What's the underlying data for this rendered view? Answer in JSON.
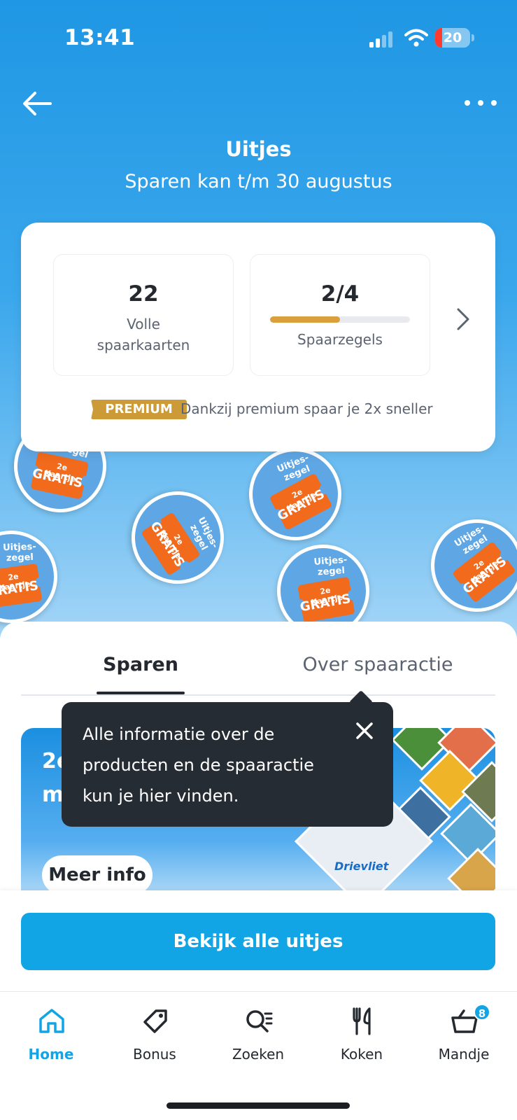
{
  "status": {
    "time": "13:41",
    "battery": "20"
  },
  "header": {
    "title": "Uitjes",
    "subtitle": "Sparen kan t/m 30 augustus"
  },
  "card": {
    "full_cards_value": "22",
    "full_cards_label_line1": "Volle",
    "full_cards_label_line2": "spaarkaarten",
    "stamps_value": "2/4",
    "stamps_label": "Spaarzegels",
    "stamps_progress": 0.5,
    "premium_badge": "PREMIUM",
    "premium_text": "Dankzij premium spaar je 2x sneller"
  },
  "stamps": {
    "arc_text": "Uitjes-zegel",
    "line1": "2e Kaartje",
    "line2": "GRATIS"
  },
  "tabs": {
    "sparen": "Sparen",
    "over": "Over spaaractie"
  },
  "promo": {
    "title_line1": "2e",
    "title_line2": "m",
    "logo": "Drievliet",
    "button": "Meer info"
  },
  "tooltip": {
    "line1": "Alle informatie over de",
    "line2": "producten en de spaaractie",
    "line3": "kun je hier vinden."
  },
  "cta": {
    "label": "Bekijk alle uitjes"
  },
  "nav": {
    "home": "Home",
    "bonus": "Bonus",
    "zoeken": "Zoeken",
    "koken": "Koken",
    "mandje": "Mandje",
    "mandje_count": "8"
  },
  "colors": {
    "accent": "#12a5e6",
    "premium": "#cc9a37",
    "progress": "#d9a03d",
    "tooltip_bg": "#262c33",
    "stamp_orange": "#f26a1b"
  }
}
